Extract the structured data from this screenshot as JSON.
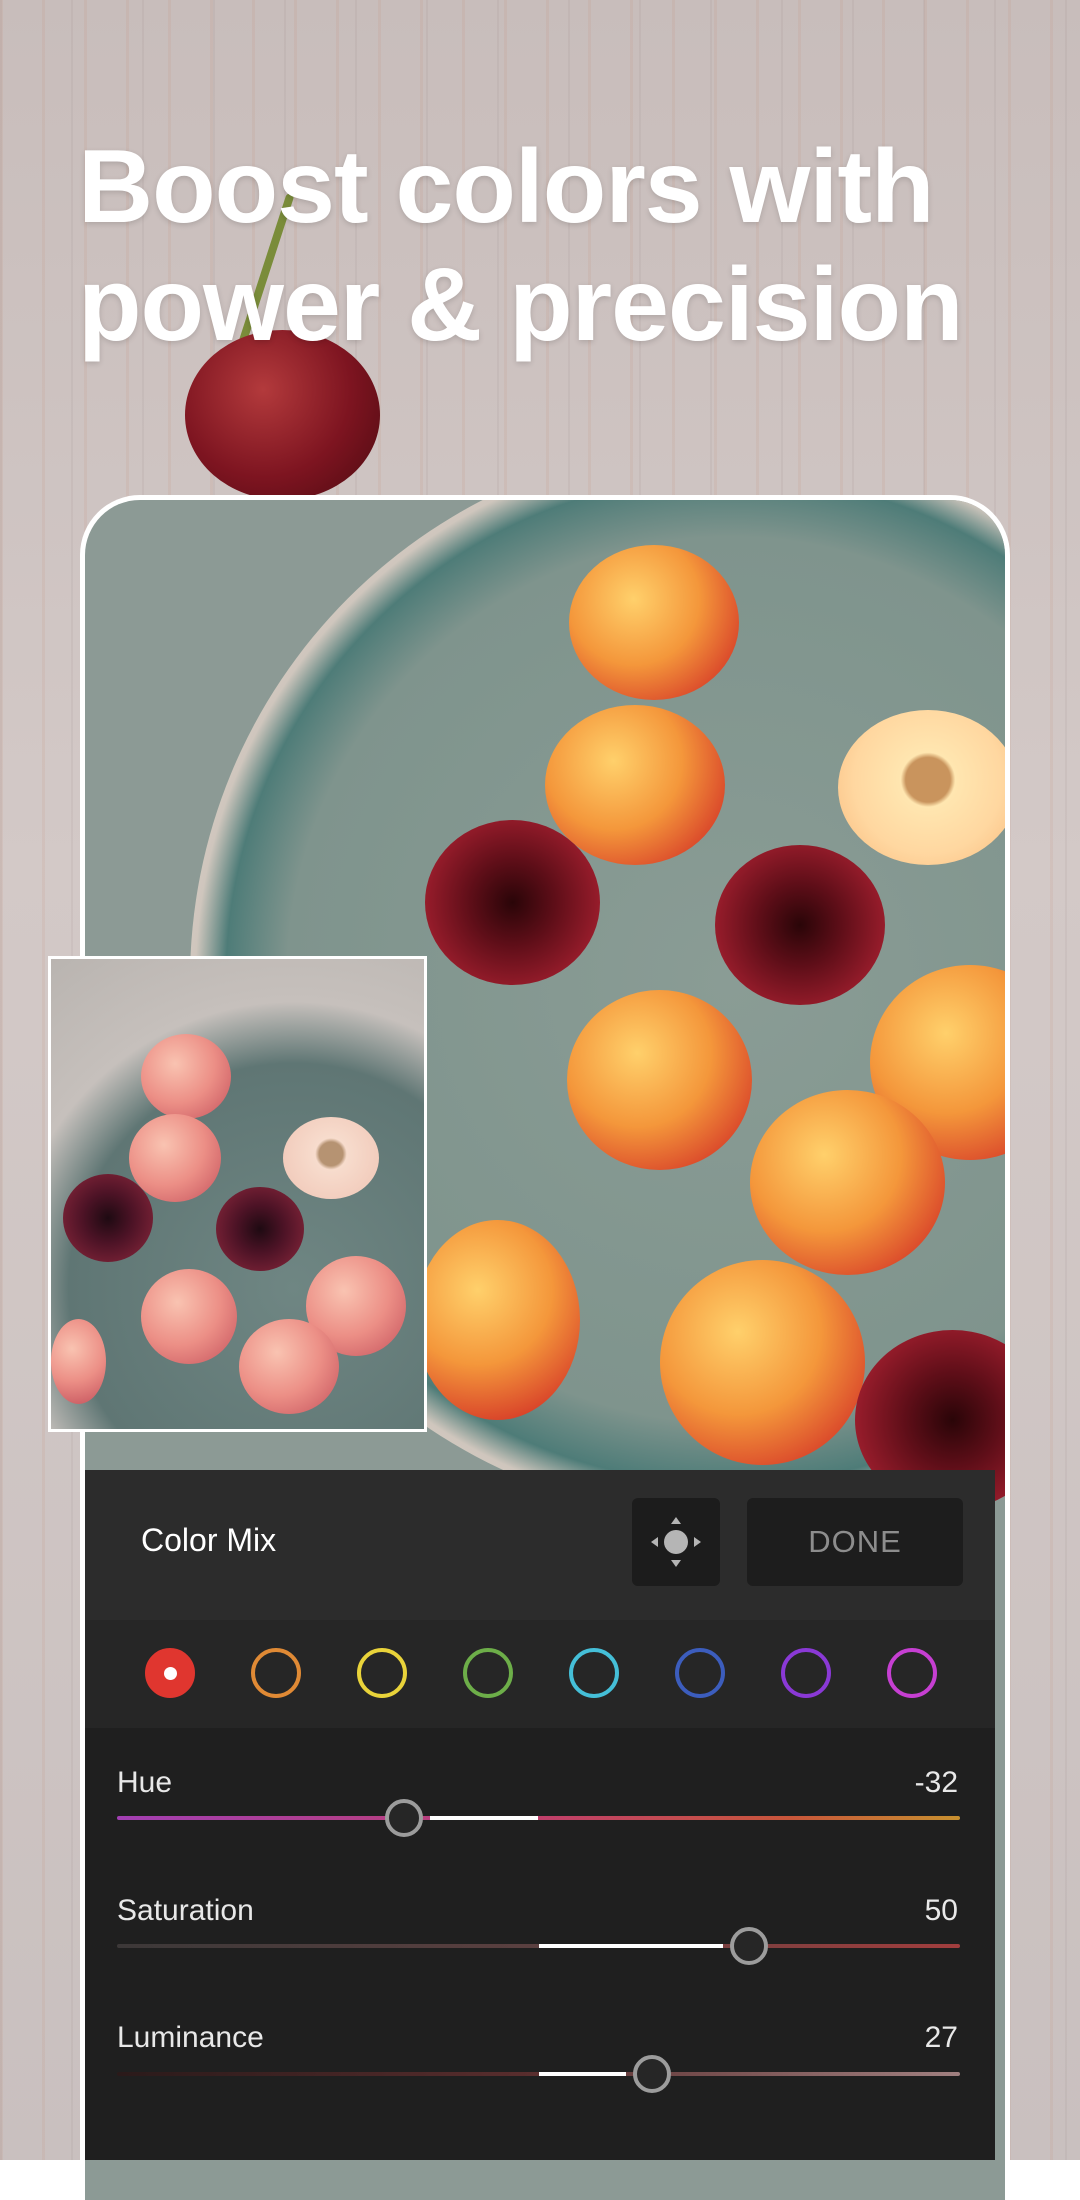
{
  "headline": {
    "line1": "Boost colors with",
    "line2": "power & precision"
  },
  "panel": {
    "title": "Color Mix",
    "target_icon": "target-adjust-icon",
    "done_label": "DONE",
    "swatches": [
      {
        "name": "red",
        "color": "#e0362f",
        "selected": true
      },
      {
        "name": "orange",
        "color": "#e08a35",
        "selected": false
      },
      {
        "name": "yellow",
        "color": "#e9d33a",
        "selected": false
      },
      {
        "name": "green",
        "color": "#6dae49",
        "selected": false
      },
      {
        "name": "aqua",
        "color": "#45bfd8",
        "selected": false
      },
      {
        "name": "blue",
        "color": "#3c5dbd",
        "selected": false
      },
      {
        "name": "purple",
        "color": "#8a39d6",
        "selected": false
      },
      {
        "name": "magenta",
        "color": "#c63fd2",
        "selected": false
      }
    ],
    "sliders": [
      {
        "label": "Hue",
        "value": "-32",
        "level": -32
      },
      {
        "label": "Saturation",
        "value": "50",
        "level": 50
      },
      {
        "label": "Luminance",
        "value": "27",
        "level": 27
      }
    ]
  }
}
